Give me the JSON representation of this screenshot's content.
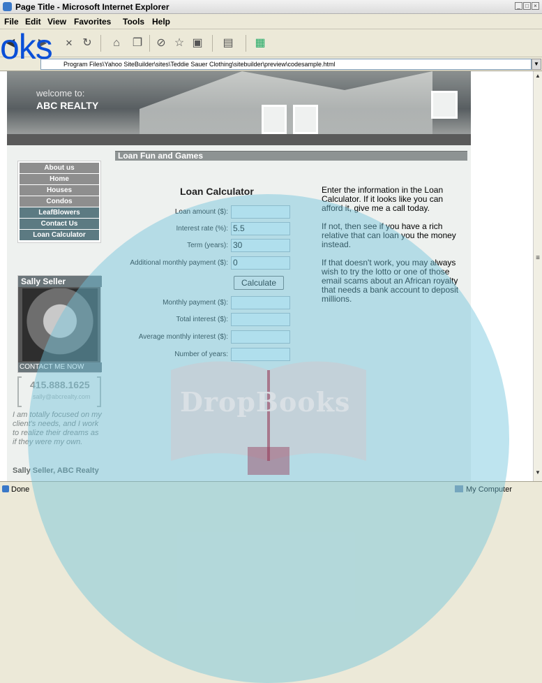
{
  "window": {
    "title": "Page Title - Microsoft Internet Explorer",
    "controls": [
      "_",
      "□",
      "×"
    ]
  },
  "menu": [
    "File",
    "Edit",
    "View",
    "Favorites",
    "Tools",
    "Help"
  ],
  "toolbar_icons": [
    "back-icon",
    "forward-icon",
    "stop-icon",
    "refresh-icon",
    "home-icon",
    "copy-icon",
    "history-icon",
    "favorites-icon",
    "media-icon",
    "clipboard-icon",
    "network-icon"
  ],
  "address": {
    "url": "Program Files\\Yahoo SiteBuilder\\sites\\Teddie Sauer Clothing\\sitebuilder\\preview\\codesample.html"
  },
  "overlay_logo": "oks",
  "site": {
    "welcome": "welcome to:",
    "brand": "ABC REALTY",
    "nav": [
      "About us",
      "Home",
      "Houses",
      "Condos",
      "LeafBlowers",
      "Contact Us",
      "Loan Calculator"
    ]
  },
  "agent": {
    "name": "Sally Seller",
    "contact_label": "CONTACT ME NOW",
    "phone": "415.888.1625",
    "email": "sally@abcrealty.com",
    "quote": "I am totally focused on my client's needs, and I work to realize their dreams as if they were my own.",
    "signature": "Sally Seller, ABC Realty"
  },
  "section": {
    "header": "Loan Fun and Games",
    "calc_title": "Loan Calculator",
    "fields": [
      {
        "label": "Loan amount ($):",
        "value": ""
      },
      {
        "label": "Interest rate (%):",
        "value": "5.5"
      },
      {
        "label": "Term (years):",
        "value": "30"
      },
      {
        "label": "Additional monthly payment ($):",
        "value": "0"
      }
    ],
    "button": "Calculate",
    "results": [
      {
        "label": "Monthly payment ($):",
        "value": ""
      },
      {
        "label": "Total interest ($):",
        "value": ""
      },
      {
        "label": "Average monthly interest ($):",
        "value": ""
      },
      {
        "label": "Number of years:",
        "value": ""
      }
    ],
    "paragraphs": [
      "Enter the information in the Loan Calculator. If it looks like you can afford it, give me a call today.",
      "If not, then see if you have a rich relative that can loan you the money instead.",
      "If that doesn't work, you may always wish to try the lotto or one of those email scams about an African royalty that needs a bank account to deposit millions."
    ]
  },
  "status": {
    "left": "Done",
    "zone": "My Computer"
  },
  "watermark": {
    "text": "DropBooks"
  }
}
